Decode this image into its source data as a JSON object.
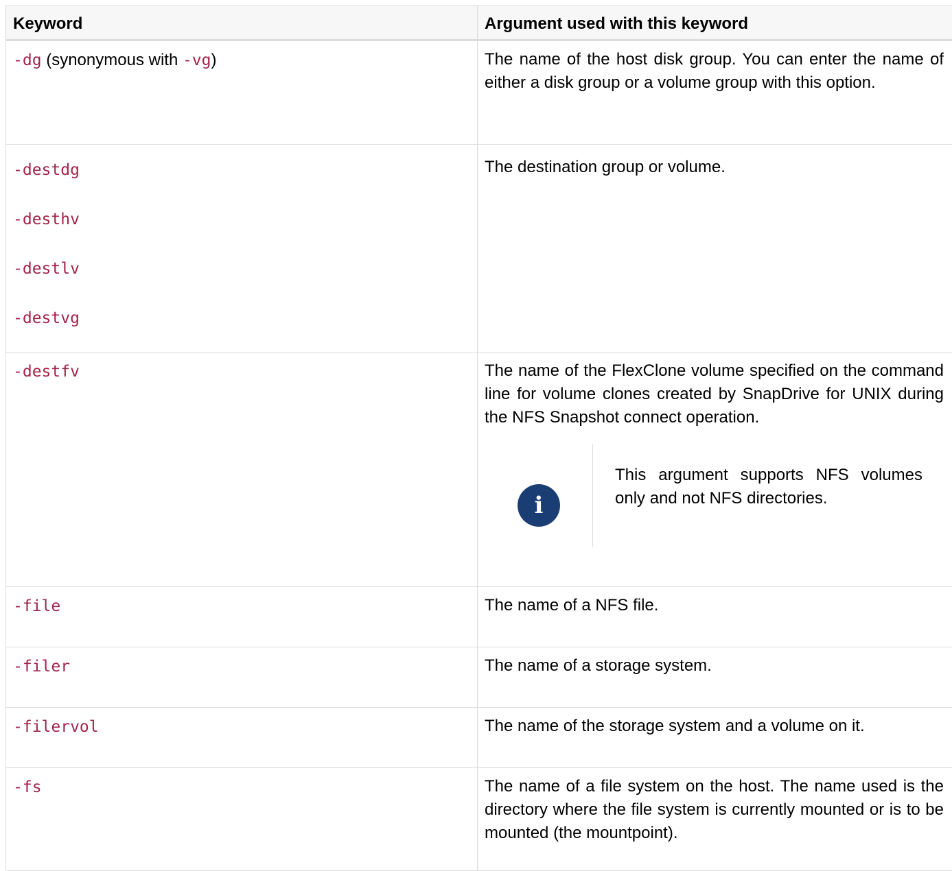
{
  "headers": {
    "keyword": "Keyword",
    "argument": "Argument used with this keyword"
  },
  "rows": [
    {
      "keyword_prefix": "-dg",
      "keyword_middle": " (synonymous with ",
      "keyword_alt": "-vg",
      "keyword_suffix": ")",
      "argument": "The name of the host disk group. You can enter the name of either a disk group or a volume group with this option."
    },
    {
      "keywords": [
        "-destdg",
        "-desthv",
        "-destlv",
        "-destvg"
      ],
      "argument": "The destination group or volume."
    },
    {
      "keyword": "-destfv",
      "argument": "The name of the FlexClone volume specified on the command line for volume clones created by SnapDrive for UNIX during the NFS Snapshot connect operation.",
      "note": {
        "icon": "info-icon",
        "icon_glyph": "i",
        "text": "This argument supports NFS volumes only and not NFS directories."
      }
    },
    {
      "keyword": "-file",
      "argument": "The name of a NFS file."
    },
    {
      "keyword": "-filer",
      "argument": "The name of a storage system."
    },
    {
      "keyword": "-filervol",
      "argument": "The name of the storage system and a volume on it."
    },
    {
      "keyword": "-fs",
      "argument": "The name of a file system on the host. The name used is the directory where the file system is currently mounted or is to be mounted (the mountpoint)."
    }
  ],
  "colors": {
    "code": "#a0254a",
    "border": "#dcdcdc",
    "header_bg": "#f7f7f7",
    "info_icon_bg": "#1a3e73"
  }
}
